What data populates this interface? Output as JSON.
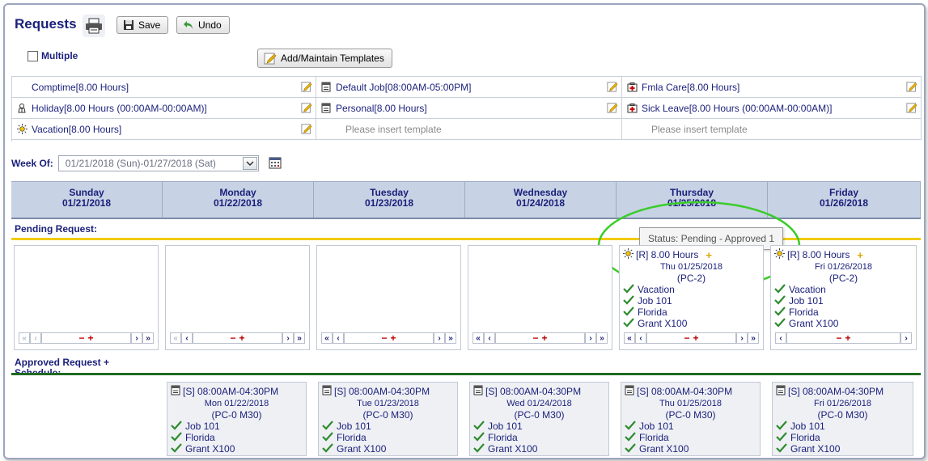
{
  "header": {
    "title": "Requests",
    "save_label": "Save",
    "undo_label": "Undo"
  },
  "options": {
    "multiple_label": "Multiple",
    "multiple_checked": false,
    "templates_button": "Add/Maintain Templates"
  },
  "templates": [
    [
      {
        "icon": "none",
        "label": "Comptime[8.00 Hours]"
      },
      {
        "icon": "schedule-icon",
        "label": "Default Job[08:00AM-05:00PM]"
      },
      {
        "icon": "medical-icon",
        "label": "Fmla Care[8.00 Hours]"
      }
    ],
    [
      {
        "icon": "holiday-icon",
        "label": "Holiday[8.00 Hours (00:00AM-00:00AM)]"
      },
      {
        "icon": "schedule-icon",
        "label": "Personal[8.00 Hours]"
      },
      {
        "icon": "medical-icon",
        "label": "Sick Leave[8.00 Hours (00:00AM-00:00AM)]"
      }
    ],
    [
      {
        "icon": "sun-icon",
        "label": "Vacation[8.00 Hours]"
      },
      {
        "icon": "none",
        "label": "Please insert template",
        "placeholder": true
      },
      {
        "icon": "none",
        "label": "Please insert template",
        "placeholder": true
      }
    ]
  ],
  "week": {
    "label": "Week Of:",
    "value": "01/21/2018 (Sun)-01/27/2018 (Sat)"
  },
  "days": [
    {
      "name": "Sunday",
      "date": "01/21/2018"
    },
    {
      "name": "Monday",
      "date": "01/22/2018"
    },
    {
      "name": "Tuesday",
      "date": "01/23/2018"
    },
    {
      "name": "Wednesday",
      "date": "01/24/2018"
    },
    {
      "name": "Thursday",
      "date": "01/25/2018"
    },
    {
      "name": "Friday",
      "date": "01/26/2018"
    }
  ],
  "pending": {
    "label": "Pending Request:",
    "tooltip": "Status: Pending - Approved 1",
    "cards": {
      "thursday": {
        "head": "[R] 8.00 Hours",
        "date": "Thu 01/25/2018",
        "pc": "(PC-2)",
        "items": [
          "Vacation",
          "Job 101",
          "Florida",
          "Grant X100"
        ]
      },
      "friday": {
        "head": "[R] 8.00 Hours",
        "date": "Fri 01/26/2018",
        "pc": "(PC-2)",
        "items": [
          "Vacation",
          "Job 101",
          "Florida",
          "Grant X100"
        ]
      }
    },
    "nav": {
      "first": "«",
      "prev": "‹",
      "minus": "−",
      "plus": "+",
      "next": "›",
      "last": "»"
    }
  },
  "approved": {
    "label_line1": "Approved Request +",
    "label_line2": "Schedule:",
    "cards": [
      {
        "head": "[S] 08:00AM-04:30PM",
        "date": "Mon 01/22/2018",
        "pc": "(PC-0 M30)",
        "items": [
          "Job 101",
          "Florida",
          "Grant X100"
        ]
      },
      {
        "head": "[S] 08:00AM-04:30PM",
        "date": "Tue 01/23/2018",
        "pc": "(PC-0 M30)",
        "items": [
          "Job 101",
          "Florida",
          "Grant X100"
        ]
      },
      {
        "head": "[S] 08:00AM-04:30PM",
        "date": "Wed 01/24/2018",
        "pc": "(PC-0 M30)",
        "items": [
          "Job 101",
          "Florida",
          "Grant X100"
        ]
      },
      {
        "head": "[S] 08:00AM-04:30PM",
        "date": "Thu 01/25/2018",
        "pc": "(PC-0 M30)",
        "items": [
          "Job 101",
          "Florida",
          "Grant X100"
        ]
      },
      {
        "head": "[S] 08:00AM-04:30PM",
        "date": "Fri 01/26/2018",
        "pc": "(PC-0 M30)",
        "items": [
          "Job 101",
          "Florida",
          "Grant X100"
        ]
      }
    ]
  },
  "colors": {
    "pending_line": "#f0cc00",
    "approved_line": "#1f6b1f",
    "highlight": "#3bcc2a",
    "text_navy": "#1a1f7a"
  }
}
